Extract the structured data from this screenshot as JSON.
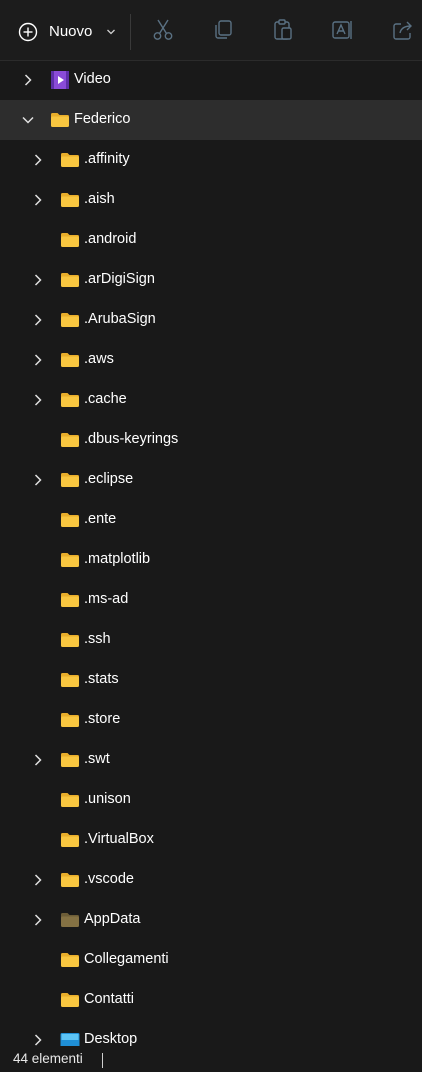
{
  "toolbar": {
    "new_label": "Nuovo",
    "icons": [
      "plus-circle-icon",
      "chevron-down-icon",
      "cut-icon",
      "copy-icon",
      "paste-icon",
      "rename-icon",
      "share-icon"
    ]
  },
  "tree": {
    "items": [
      {
        "label": "Video",
        "level": 0,
        "expandable": true,
        "expanded": false,
        "icon": "video-folder-icon"
      },
      {
        "label": "Federico",
        "level": 0,
        "expandable": true,
        "expanded": true,
        "selected": true,
        "icon": "folder-icon"
      },
      {
        "label": ".affinity",
        "level": 1,
        "expandable": true,
        "icon": "folder-icon"
      },
      {
        "label": ".aish",
        "level": 1,
        "expandable": true,
        "icon": "folder-icon"
      },
      {
        "label": ".android",
        "level": 1,
        "expandable": false,
        "icon": "folder-icon"
      },
      {
        "label": ".arDigiSign",
        "level": 1,
        "expandable": true,
        "icon": "folder-icon"
      },
      {
        "label": ".ArubaSign",
        "level": 1,
        "expandable": true,
        "icon": "folder-icon"
      },
      {
        "label": ".aws",
        "level": 1,
        "expandable": true,
        "icon": "folder-icon"
      },
      {
        "label": ".cache",
        "level": 1,
        "expandable": true,
        "icon": "folder-icon"
      },
      {
        "label": ".dbus-keyrings",
        "level": 1,
        "expandable": false,
        "icon": "folder-icon"
      },
      {
        "label": ".eclipse",
        "level": 1,
        "expandable": true,
        "icon": "folder-icon"
      },
      {
        "label": ".ente",
        "level": 1,
        "expandable": false,
        "icon": "folder-icon"
      },
      {
        "label": ".matplotlib",
        "level": 1,
        "expandable": false,
        "icon": "folder-icon"
      },
      {
        "label": ".ms-ad",
        "level": 1,
        "expandable": false,
        "icon": "folder-icon"
      },
      {
        "label": ".ssh",
        "level": 1,
        "expandable": false,
        "icon": "folder-icon"
      },
      {
        "label": ".stats",
        "level": 1,
        "expandable": false,
        "icon": "folder-icon"
      },
      {
        "label": ".store",
        "level": 1,
        "expandable": false,
        "icon": "folder-icon"
      },
      {
        "label": ".swt",
        "level": 1,
        "expandable": true,
        "icon": "folder-icon"
      },
      {
        "label": ".unison",
        "level": 1,
        "expandable": false,
        "icon": "folder-icon"
      },
      {
        "label": ".VirtualBox",
        "level": 1,
        "expandable": false,
        "icon": "folder-icon"
      },
      {
        "label": ".vscode",
        "level": 1,
        "expandable": true,
        "icon": "folder-icon"
      },
      {
        "label": "AppData",
        "level": 1,
        "expandable": true,
        "icon": "hidden-folder-icon"
      },
      {
        "label": "Collegamenti",
        "level": 1,
        "expandable": false,
        "icon": "folder-icon"
      },
      {
        "label": "Contatti",
        "level": 1,
        "expandable": false,
        "icon": "folder-icon"
      },
      {
        "label": "Desktop",
        "level": 1,
        "expandable": true,
        "icon": "desktop-folder-icon"
      }
    ]
  },
  "status": {
    "count_text": "44 elementi"
  },
  "colors": {
    "folder": "#f8c640",
    "folder_tab": "#e9ae2a",
    "hidden_folder": "#857244",
    "selected_row": "#2d2d2d",
    "video_folder": "#8a4bd8"
  }
}
